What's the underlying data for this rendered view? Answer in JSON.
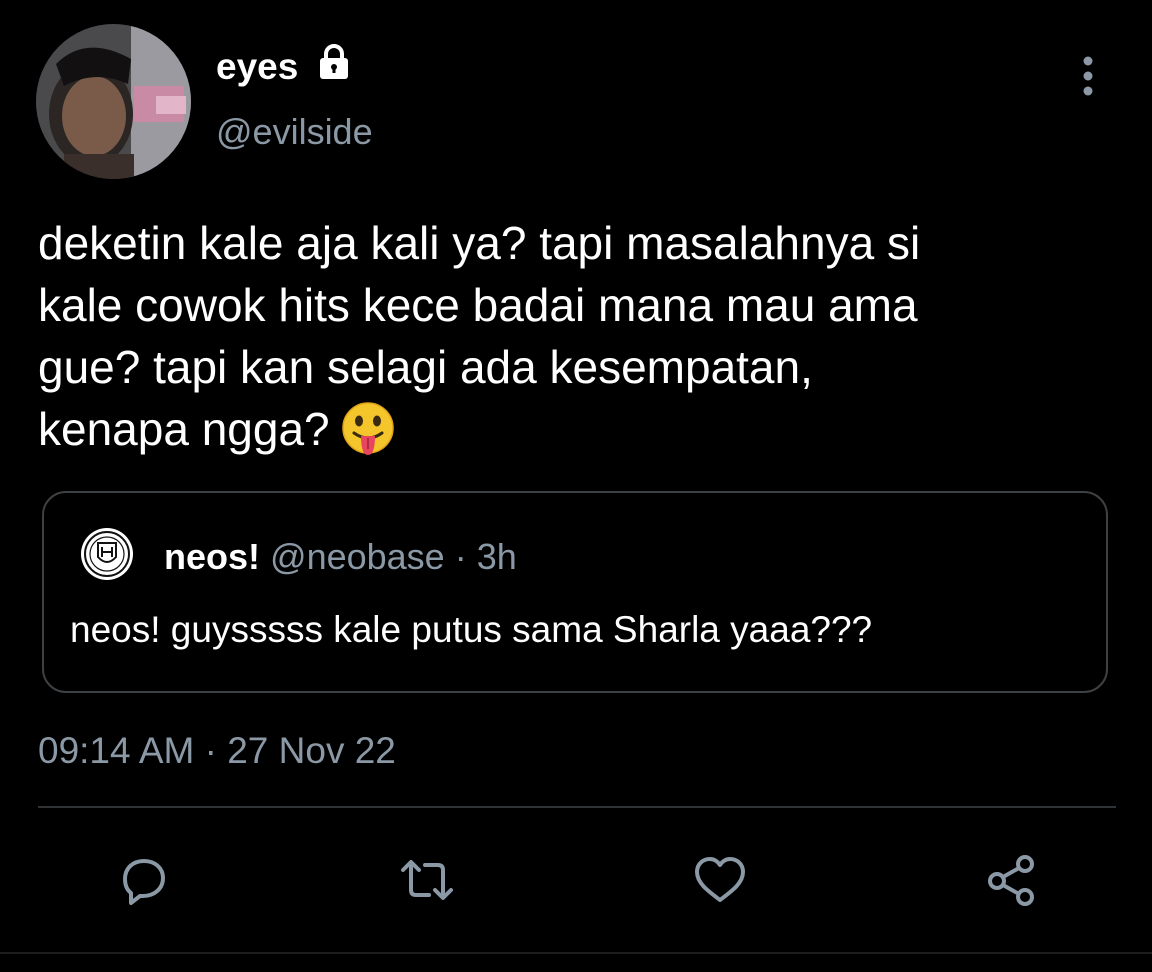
{
  "author": {
    "display_name": "eyes",
    "handle": "@evilside",
    "protected_icon": "lock-icon",
    "avatar": "avatar-photo"
  },
  "menu_icon": "more-vertical-icon",
  "tweet": {
    "lines": [
      "deketin kale aja kali ya? tapi masalahnya si",
      "kale cowok hits kece badai mana mau ama",
      "gue? tapi kan selagi ada kesempatan,",
      "kenapa ngga?"
    ],
    "emoji": "face-with-tongue-emoji"
  },
  "quote": {
    "name": "neos!",
    "handle": "@neobase",
    "separator": "·",
    "age": "3h",
    "text": "neos! guysssss kale putus sama Sharla yaaa???",
    "avatar": "neos-crest-logo"
  },
  "timestamp": "09:14 AM · 27 Nov 22",
  "actions": [
    {
      "name": "reply",
      "icon": "reply-icon"
    },
    {
      "name": "retweet",
      "icon": "retweet-icon"
    },
    {
      "name": "like",
      "icon": "heart-icon"
    },
    {
      "name": "share",
      "icon": "share-icon"
    }
  ],
  "colors": {
    "background": "#000000",
    "primary_text": "#ffffff",
    "secondary_text": "#8b98a5",
    "border": "#3e4144",
    "divider": "#2f3336"
  }
}
